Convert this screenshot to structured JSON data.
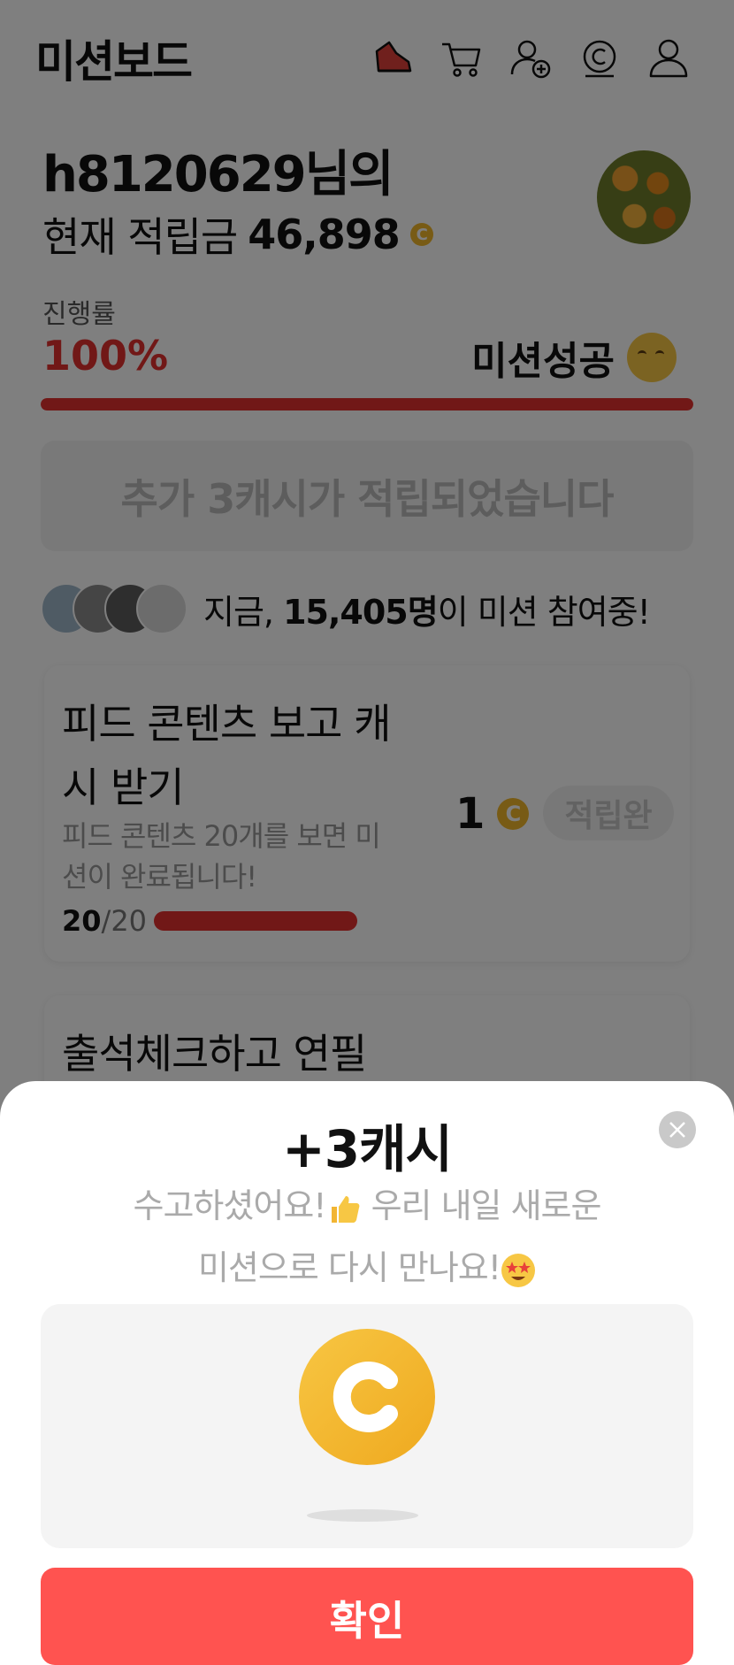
{
  "header": {
    "title": "미션보드",
    "icons": [
      "sneaker-icon",
      "cart-icon",
      "add-friend-icon",
      "cash-icon",
      "profile-icon"
    ]
  },
  "summary": {
    "user_title": "h8120629님의",
    "points_label": "현재 적립금",
    "points_value": "46,898",
    "coin_symbol": "C"
  },
  "progress": {
    "label": "진행률",
    "value": "100%",
    "fraction": 1.0,
    "status": "미션성공",
    "bar_color": "#e3302e"
  },
  "notice": {
    "text": "추가 3캐시가 적립되었습니다"
  },
  "participants": {
    "prefix": "지금,",
    "count": "15,405명",
    "suffix": "이 미션 참여중!"
  },
  "missions": [
    {
      "title": "피드 콘텐츠 보고 캐시 받기",
      "description": "피드 콘텐츠 20개를 보면 미션이 완료됩니다!",
      "progress_current": "20",
      "progress_total": "/20",
      "reward": "1",
      "button": "적립완"
    },
    {
      "title": "출석체크하고 연필"
    }
  ],
  "sheet": {
    "title": "+3캐시",
    "message_line1": "수고하셨어요!",
    "message_line1b": " 우리 내일 새로운",
    "message_line2": "미션으로 다시 만나요!",
    "coin_symbol": "C",
    "confirm_label": "확인"
  }
}
